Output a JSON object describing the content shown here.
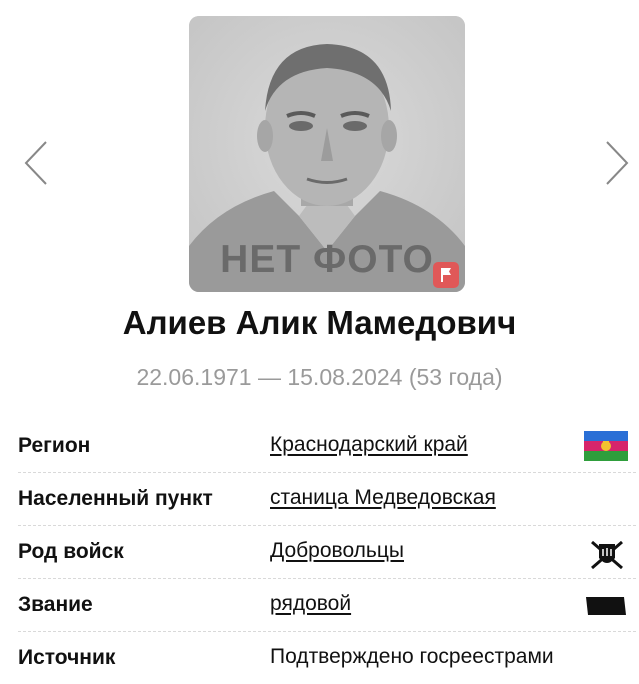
{
  "photo": {
    "placeholder_text": "НЕТ ФОТО"
  },
  "person": {
    "name": "Алиев Алик Мамедович",
    "dates": "22.06.1971 — 15.08.2024 (53 года)"
  },
  "details": [
    {
      "label": "Регион",
      "value": "Краснодарский край",
      "icon": "krasnodar-flag-icon"
    },
    {
      "label": "Населенный пункт",
      "value": "станица Медведовская"
    },
    {
      "label": "Род войск",
      "value": "Добровольцы",
      "icon": "volunteers-emblem-icon"
    },
    {
      "label": "Звание",
      "value": "рядовой",
      "icon": "private-rank-icon"
    },
    {
      "label": "Источник",
      "value": "Подтверждено госреестрами"
    }
  ],
  "colors": {
    "flag_blue": "#2a6fd6",
    "flag_red": "#d6256b",
    "flag_green": "#2f9e3c",
    "report_button": "#e05858",
    "dates_gray": "#9a9a9a"
  }
}
